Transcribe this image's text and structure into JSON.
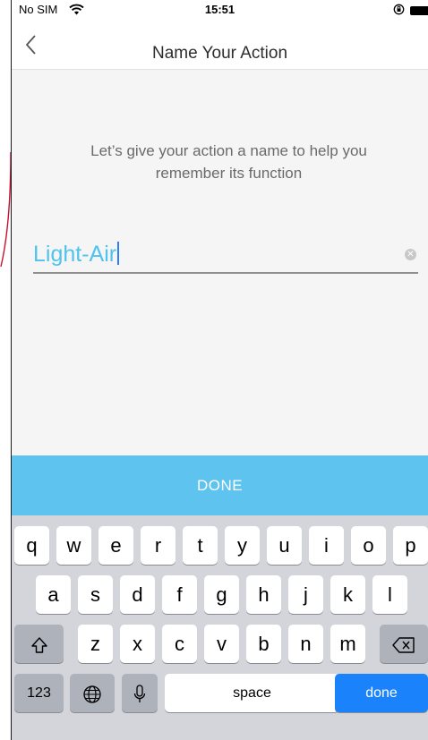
{
  "status_bar": {
    "carrier": "No SIM",
    "time": "15:51"
  },
  "nav": {
    "title": "Name Your Action",
    "back_icon": "chevron-left-icon"
  },
  "prompt": "Let’s give your action a name to help you remember its function",
  "name_field": {
    "value": "Light-Air",
    "clear_icon": "clear-icon"
  },
  "done_bar": {
    "label": "DONE"
  },
  "keyboard": {
    "row1": [
      "q",
      "w",
      "e",
      "r",
      "t",
      "y",
      "u",
      "i",
      "o",
      "p"
    ],
    "row2": [
      "a",
      "s",
      "d",
      "f",
      "g",
      "h",
      "j",
      "k",
      "l"
    ],
    "row3": [
      "z",
      "x",
      "c",
      "v",
      "b",
      "n",
      "m"
    ],
    "numbers_label": "123",
    "space_label": "space",
    "return_label": "done",
    "colors": {
      "return_key": "#1a82fb",
      "background": "#d3d5da"
    }
  },
  "colors": {
    "accent": "#5ec3ee",
    "field_text": "#4fc3ec"
  }
}
